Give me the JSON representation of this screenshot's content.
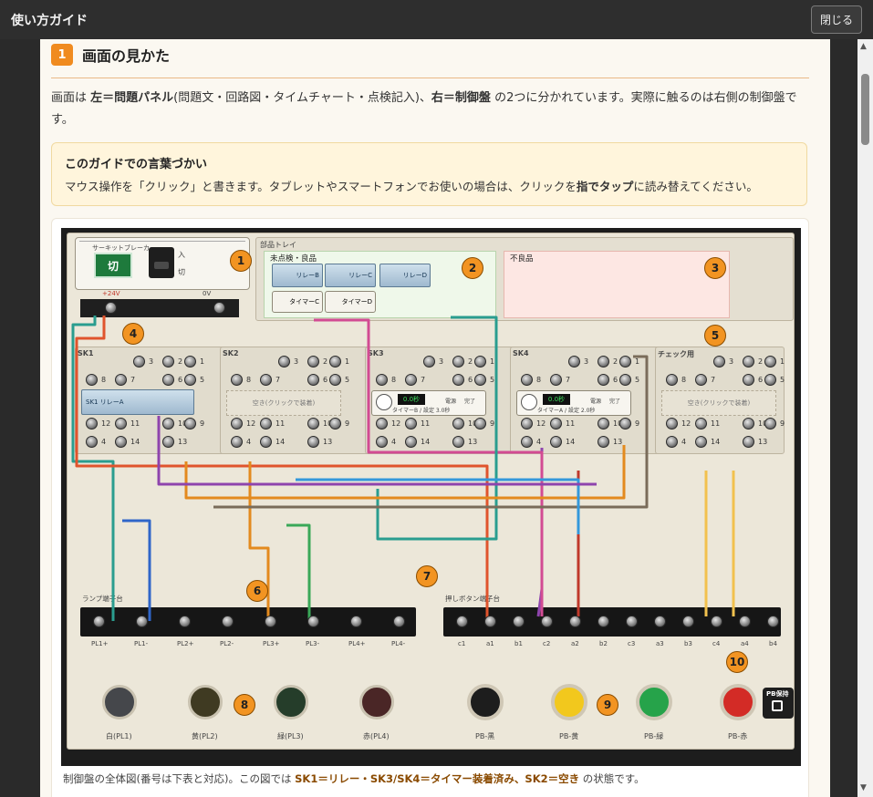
{
  "window": {
    "title": "使い方ガイド",
    "close_label": "閉じる"
  },
  "section": {
    "number": "1",
    "title": "画面の見かた",
    "intro": {
      "t1": "画面は ",
      "b1": "左＝問題パネル",
      "t2": "(問題文・回路図・タイムチャート・点検記入)、",
      "b2": "右＝制御盤",
      "t3": " の2つに分かれています。実際に触るのは右側の制御盤です。"
    }
  },
  "note": {
    "title": "このガイドでの言葉づかい",
    "t1": "マウス操作を「クリック」と書きます。タブレットやスマートフォンでお使いの場合は、クリックを",
    "b1": "指でタップ",
    "t2": "に読み替えてください。"
  },
  "figure": {
    "breaker": {
      "title": "サーキットブレーカ",
      "switch": "切",
      "on": "入",
      "off": "切",
      "v1": "+24V",
      "v2": "0V"
    },
    "tray": {
      "title": "部品トレイ",
      "unchecked": "未点検・良品",
      "defective": "不良品",
      "parts": [
        "リレーB",
        "リレーC",
        "リレーD",
        "タイマーC",
        "タイマーD"
      ]
    },
    "sockets": [
      {
        "name": "SK1",
        "mod": "SK1 リレーA"
      },
      {
        "name": "SK2",
        "empty": "空き(クリックで装着)"
      },
      {
        "name": "SK3",
        "timer": "タイマーB / 設定 3.0秒",
        "disp": "0.0秒",
        "l1": "電源",
        "l2": "完了"
      },
      {
        "name": "SK4",
        "timer": "タイマーA / 設定 2.0秒",
        "disp": "0.0秒",
        "l1": "電源",
        "l2": "完了"
      },
      {
        "name": "チェック用",
        "empty": "空き(クリックで装着)"
      }
    ],
    "terminal_numbers": [
      "1",
      "2",
      "3",
      "4",
      "5",
      "6",
      "7",
      "8",
      "9",
      "10",
      "11",
      "12",
      "13",
      "14"
    ],
    "lamp_strip": {
      "title": "ランプ端子台",
      "terms": [
        "PL1+",
        "PL1-",
        "PL2+",
        "PL2-",
        "PL3+",
        "PL3-",
        "PL4+",
        "PL4-"
      ]
    },
    "pb_strip": {
      "title": "押しボタン端子台",
      "terms": [
        "c1",
        "a1",
        "b1",
        "c2",
        "a2",
        "b2",
        "c3",
        "a3",
        "b3",
        "c4",
        "a4",
        "b4"
      ]
    },
    "lamps": [
      {
        "label": "白(PL1)",
        "color": "#45474b"
      },
      {
        "label": "黄(PL2)",
        "color": "#3f3a22"
      },
      {
        "label": "緑(PL3)",
        "color": "#253d2a"
      },
      {
        "label": "赤(PL4)",
        "color": "#4a2626"
      }
    ],
    "buttons": [
      {
        "label": "PB-黒",
        "color": "#1d1d1d"
      },
      {
        "label": "PB-黄",
        "color": "#f2c81d"
      },
      {
        "label": "PB-緑",
        "color": "#26a34a"
      },
      {
        "label": "PB-赤",
        "color": "#d32b26"
      }
    ],
    "pb_hold": "PB保持",
    "callouts": [
      "1",
      "2",
      "3",
      "4",
      "5",
      "6",
      "7",
      "8",
      "9",
      "10"
    ]
  },
  "caption": {
    "t1": "制御盤の全体図(番号は下表と対応)。この図では ",
    "b1": "SK1＝リレー・SK3/SK4＝タイマー装着済み、SK2＝空き",
    "t2": " の状態です。"
  },
  "colors": {
    "accent": "#f08b1f",
    "note_bg": "#fff5dc",
    "panel": "#ece7d9"
  }
}
